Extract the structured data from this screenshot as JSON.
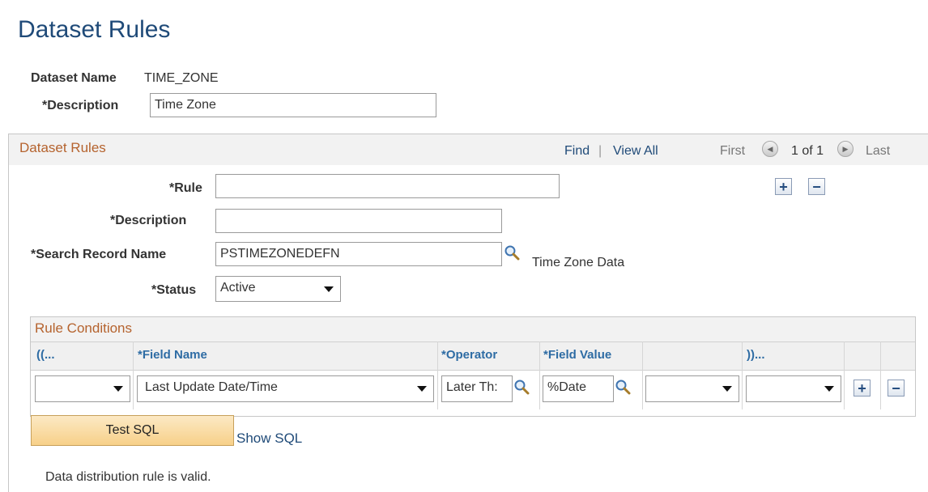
{
  "page": {
    "title": "Dataset Rules"
  },
  "header": {
    "dataset_name_label": "Dataset Name",
    "dataset_name_value": "TIME_ZONE",
    "description_label": "*Description",
    "description_value": "Time Zone"
  },
  "rules_grid": {
    "title": "Dataset Rules",
    "find_label": "Find",
    "separator": "|",
    "view_all_label": "View All",
    "first_label": "First",
    "page_info": "1 of 1",
    "last_label": "Last",
    "rule_label": "*Rule",
    "rule_value": "",
    "description_label": "*Description",
    "description_value": "",
    "search_record_label": "*Search Record Name",
    "search_record_value": "PSTIMEZONEDEFN",
    "search_record_desc": "Time Zone Data",
    "status_label": "*Status",
    "status_value": "Active",
    "add_icon": "plus-icon",
    "delete_icon": "minus-icon"
  },
  "rule_conditions": {
    "title": "Rule Conditions",
    "columns": [
      "((...",
      "*Field Name",
      "*Operator",
      "*Field Value",
      "",
      "))...",
      "",
      ""
    ],
    "row": {
      "open_paren": "",
      "field_name": "Last Update Date/Time",
      "operator": "Later Th:",
      "field_value": "%Date",
      "extra": "",
      "close_paren": ""
    }
  },
  "actions": {
    "test_sql_label": "Test SQL",
    "show_sql_label": "Show SQL"
  },
  "status_message": "Data distribution rule is valid.",
  "colors": {
    "title_blue": "#1f4a78",
    "section_orange": "#b5632e",
    "column_header_blue": "#2e6ca4",
    "button_orange": "#f7d089"
  }
}
